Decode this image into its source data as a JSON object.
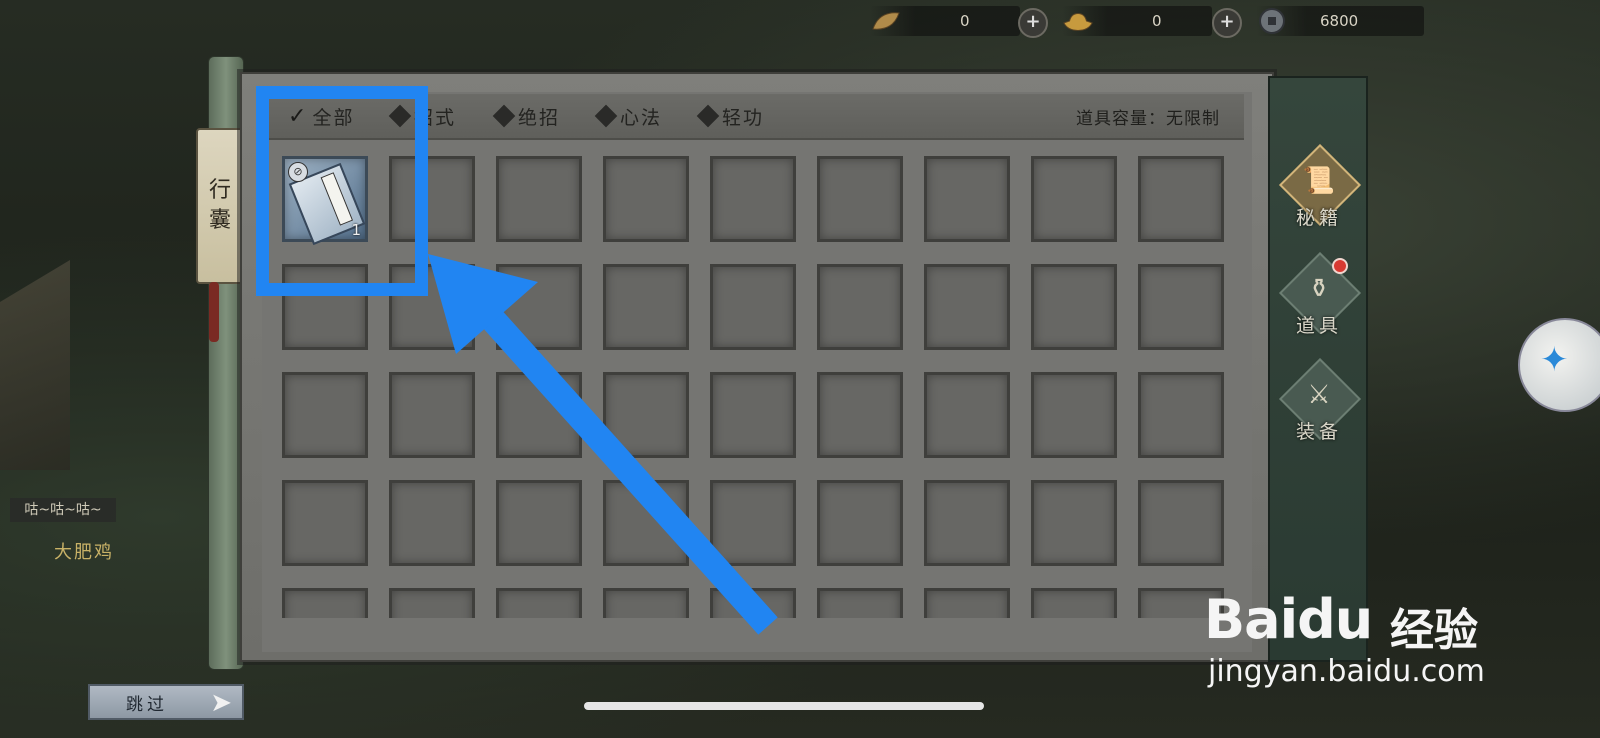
{
  "resources": [
    {
      "icon": "leaf-coin-icon",
      "value": "0"
    },
    {
      "icon": "gold-ingot-icon",
      "value": "0"
    },
    {
      "icon": "copper-coin-icon",
      "value": "6800"
    }
  ],
  "scroll_tab": {
    "line1": "行",
    "line2": "囊"
  },
  "tabs": [
    {
      "label": "全部",
      "selected": true
    },
    {
      "label": "招式",
      "selected": false
    },
    {
      "label": "绝招",
      "selected": false
    },
    {
      "label": "心法",
      "selected": false
    },
    {
      "label": "轻功",
      "selected": false
    }
  ],
  "capacity": "道具容量：无限制",
  "grid": {
    "columns": 9,
    "rows_visible": 5
  },
  "items": [
    {
      "name": "book-item",
      "quantity": "1",
      "slot": 0
    }
  ],
  "side_nav": [
    {
      "label": "秘籍",
      "active": true,
      "icon": "scroll-icon",
      "badge": false
    },
    {
      "label": "道具",
      "active": false,
      "icon": "gourd-icon",
      "badge": true
    },
    {
      "label": "装备",
      "active": false,
      "icon": "sword-icon",
      "badge": false
    }
  ],
  "skip": {
    "label": "跳过"
  },
  "npc": {
    "speech": "咕~咕~咕~",
    "name": "大肥鸡"
  },
  "watermark": {
    "brand": "Baidu",
    "brand_suffix": "经验",
    "url": "jingyan.baidu.com"
  },
  "colors": {
    "highlight": "#2185f2",
    "panel": "#757572",
    "side_panel": "#2f3f36"
  }
}
